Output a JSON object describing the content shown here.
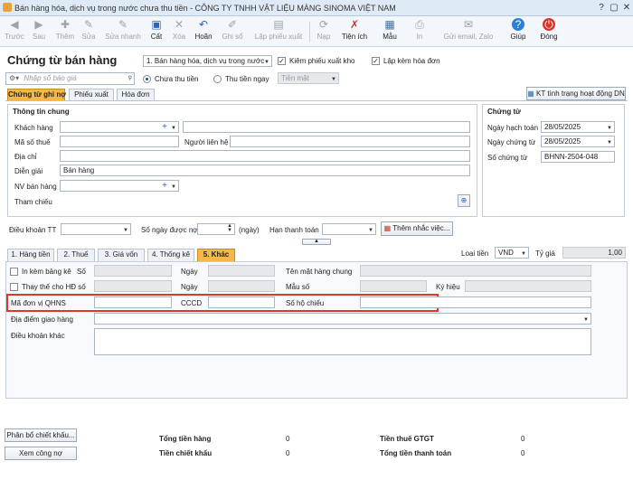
{
  "window": {
    "title": "Bán hàng hóa, dịch vụ trong nước chưa thu tiền - CÔNG TY TNHH VẬT LIỆU MÀNG SINOMA VIỆT NAM"
  },
  "toolbar": {
    "truoc": "Trước",
    "sau": "Sau",
    "them": "Thêm",
    "sua": "Sửa",
    "sua_nhanh": "Sửa nhanh",
    "cat": "Cất",
    "xoa": "Xóa",
    "hoan": "Hoãn",
    "ghi_so": "Ghi sổ",
    "lap_phieu_xuat": "Lập phiếu xuất",
    "nap": "Nạp",
    "tien_ich": "Tiện ích",
    "mau": "Mẫu",
    "in": "In",
    "gui_email": "Gửi email, Zalo",
    "giup": "Giúp",
    "dong": "Đóng"
  },
  "header": {
    "title": "Chứng từ bán hàng",
    "type_value": "1. Bán hàng hóa, dịch vụ trong nước",
    "kiem_phieu_xuat_kho": "Kiêm phiếu xuất kho",
    "lap_kem_hoa_don": "Lập kèm hóa đơn",
    "search_placeholder": "Nhập số báo giá",
    "chua_thu_tien": "Chưa thu tiền",
    "thu_tien_ngay": "Thu tiền ngay",
    "payment_method": "Tiền mặt",
    "kt_button": "KT tình trạng hoạt động DN"
  },
  "tabs": {
    "chung_tu_ghi_no": "Chứng từ ghi nợ",
    "phieu_xuat": "Phiếu xuất",
    "hoa_don": "Hóa đơn"
  },
  "general": {
    "title": "Thông tin chung",
    "khach_hang": "Khách hàng",
    "ma_so_thue": "Mã số thuế",
    "nguoi_lien_he": "Người liên hệ",
    "dia_chi": "Địa chỉ",
    "dien_giai": "Diễn giải",
    "dien_giai_value": "Bán hàng",
    "nv_ban_hang": "NV bán hàng",
    "tham_chieu": "Tham chiếu"
  },
  "voucher": {
    "title": "Chứng từ",
    "ngay_hach_toan": "Ngày hạch toán",
    "ngay_hach_toan_value": "28/05/2025",
    "ngay_chung_tu": "Ngày chứng từ",
    "ngay_chung_tu_value": "28/05/2025",
    "so_chung_tu": "Số chứng từ",
    "so_chung_tu_value": "BHNN-2504-048"
  },
  "terms": {
    "dieu_khoan_tt": "Điều khoản TT",
    "so_ngay_duoc_no": "Số ngày được nợ",
    "ngay_unit": "(ngày)",
    "han_thanh_toan": "Hạn thanh toán",
    "them_nhac_viec": "Thêm nhắc việc..."
  },
  "subtabs": {
    "hang_tien": "1. Hàng tiền",
    "thue": "2. Thuế",
    "gia_von": "3. Giá vốn",
    "thong_ke": "4. Thống kê",
    "khac": "5. Khác",
    "loai_tien": "Loại tiền",
    "loai_tien_value": "VND",
    "ty_gia": "Tỷ giá",
    "ty_gia_value": "1,00"
  },
  "other": {
    "in_kem_bang_ke": "In kèm bảng kê",
    "so": "Số",
    "ngay": "Ngày",
    "ten_mat_hang_chung": "Tên mặt hàng chung",
    "thay_the_cho_hd_so": "Thay thế cho HĐ số",
    "mau_so": "Mẫu số",
    "ky_hieu": "Ký hiệu",
    "ma_don_vi_qhns": "Mã đơn vị QHNS",
    "cccd": "CCCD",
    "so_ho_chieu": "Số hộ chiếu",
    "dia_diem_giao_hang": "Địa điểm giao hàng",
    "dieu_khoan_khac": "Điều khoản khác"
  },
  "footer": {
    "phan_bo_chiet_khau": "Phân bổ chiết khấu...",
    "xem_cong_no": "Xem công nợ",
    "tong_tien_hang": "Tổng tiền hàng",
    "tong_tien_hang_value": "0",
    "tien_chiet_khau": "Tiền chiết khấu",
    "tien_chiet_khau_value": "0",
    "tien_thue_gtgt": "Tiền thuế GTGT",
    "tien_thue_gtgt_value": "0",
    "tong_tien_thanh_toan": "Tổng tiền thanh toán",
    "tong_tien_thanh_toan_value": "0"
  }
}
